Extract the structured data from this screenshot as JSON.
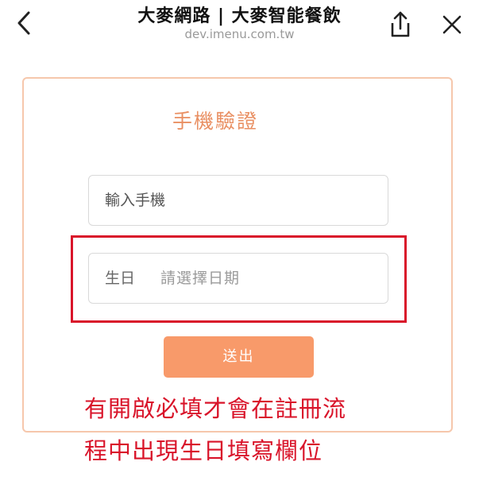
{
  "header": {
    "title": "大麥網路 | 大麥智能餐飲",
    "url": "dev.imenu.com.tw"
  },
  "form": {
    "heading": "手機驗證",
    "phone_placeholder": "輸入手機",
    "birthday_label": "生日",
    "birthday_placeholder": "請選擇日期",
    "submit_label": "送出"
  },
  "annotation": {
    "line1": "有開啟必填才會在註冊流",
    "line2": "程中出現生日填寫欄位",
    "color": "#d9142a"
  },
  "colors": {
    "accent": "#e98f62",
    "button": "#f89a6a",
    "card_border": "#f6c7ac"
  }
}
